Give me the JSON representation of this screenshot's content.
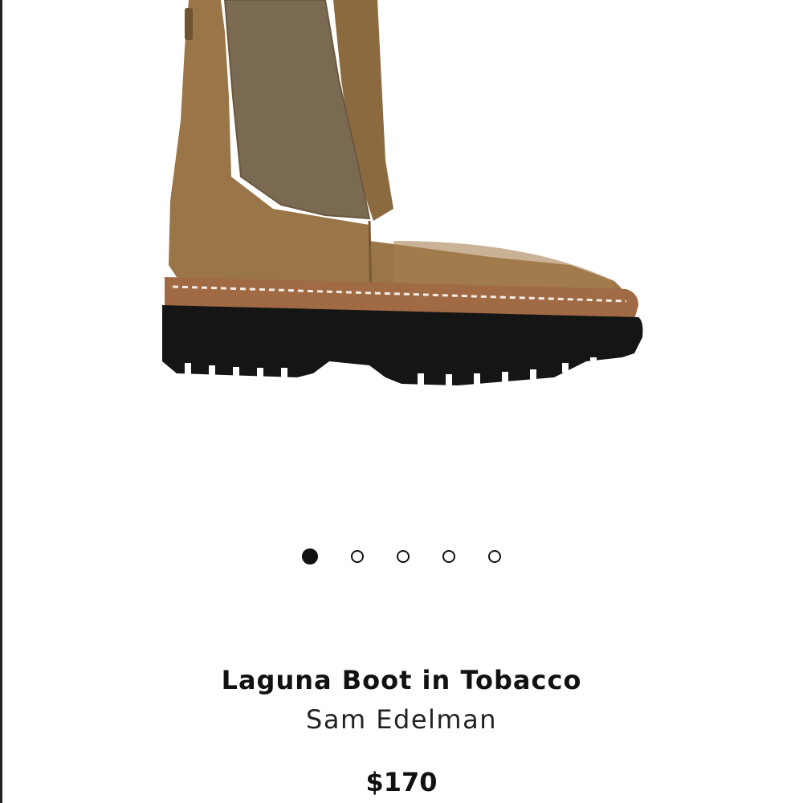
{
  "product": {
    "title": "Laguna Boot in Tobacco",
    "brand": "Sam Edelman",
    "price": "$170",
    "image_icon": "chelsea-boot-image",
    "colors": {
      "suede": "#9a7548",
      "elastic": "#7b6a52",
      "sole": "#151515",
      "welt": "#a06a45",
      "stitch": "#f2eee6"
    }
  },
  "carousel": {
    "active_index": 0,
    "total": 5
  }
}
